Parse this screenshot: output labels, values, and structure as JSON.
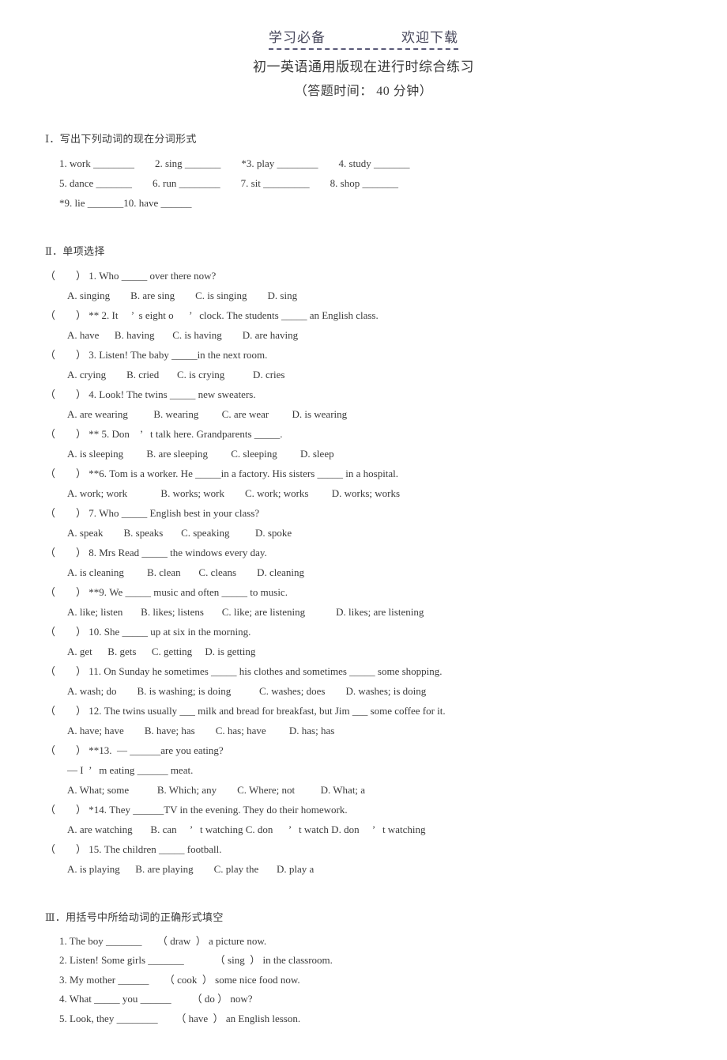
{
  "header": {
    "watermark_left": "学习必备",
    "watermark_right": "欢迎下载",
    "title": "初一英语通用版现在进行时综合练习",
    "subtitle": "（答题时间：  40 分钟）"
  },
  "section1": {
    "heading": "Ⅰ．写出下列动词的现在分词形式",
    "lines": [
      "1. work ________        2. sing _______        *3. play ________        4. study _______",
      "5. dance _______        6. run ________        7. sit _________        8. shop _______",
      "*9. lie _______10. have ______"
    ]
  },
  "section2": {
    "heading": "Ⅱ．单项选择",
    "items": [
      {
        "question": "（        ） 1. Who _____ over there now?",
        "options": "A. singing        B. are sing        C. is singing        D. sing"
      },
      {
        "question": "（        ） ** 2. It     ’  s eight o      ’   clock. The students _____ an English class.",
        "options": "A. have      B. having       C. is having        D. are having"
      },
      {
        "question": "（        ） 3. Listen! The baby _____in the next room.",
        "options": "A. crying        B. cried       C. is crying           D. cries"
      },
      {
        "question": "（        ） 4. Look! The twins _____ new sweaters.",
        "options": "A. are wearing          B. wearing         C. are wear         D. is wearing"
      },
      {
        "question": "（        ） ** 5. Don    ’   t talk here. Grandparents _____.",
        "options": "A. is sleeping         B. are sleeping         C. sleeping         D. sleep"
      },
      {
        "question": "（        ） **6. Tom is a worker. He _____in a factory. His sisters _____ in a hospital.",
        "options": "A. work; work             B. works; work        C. work; works         D. works; works"
      },
      {
        "question": "（        ） 7. Who _____ English best in your class?",
        "options": "A. speak        B. speaks       C. speaking          D. spoke"
      },
      {
        "question": "（        ） 8. Mrs Read _____ the windows every day.",
        "options": "A. is cleaning         B. clean       C. cleans        D. cleaning"
      },
      {
        "question": "（        ） **9. We _____ music and often _____ to music.",
        "options": "A. like; listen       B. likes; listens       C. like; are listening            D. likes; are listening"
      },
      {
        "question": "（        ） 10. She _____ up at six in the morning.",
        "options": "A. get      B. gets      C. getting     D. is getting"
      },
      {
        "question": "（        ） 11. On Sunday he sometimes _____ his clothes and sometimes _____ some shopping.",
        "options": "A. wash; do        B. is washing; is doing           C. washes; does        D. washes; is doing"
      },
      {
        "question": "（        ） 12. The twins usually ___ milk and bread for breakfast, but Jim ___ some coffee for it.",
        "options": "A. have; have        B. have; has        C. has; have         D. has; has"
      },
      {
        "question": "（        ） **13.  — ______are you eating?",
        "continuation": "— I  ’   m eating ______ meat.",
        "options": "A. What; some           B. Which; any        C. Where; not          D. What; a"
      },
      {
        "question": "（        ） *14. They ______TV in the evening. They do their homework.",
        "options": "A. are watching       B. can     ’   t watching C. don      ’   t watch D. don     ’   t watching"
      },
      {
        "question": "（        ） 15. The children _____ football.",
        "options": "A. is playing      B. are playing        C. play the       D. play a"
      }
    ]
  },
  "section3": {
    "heading": "Ⅲ．用括号中所给动词的正确形式填空",
    "lines": [
      "1. The boy _______      （ draw  ） a picture now.",
      "2. Listen! Some girls _______            （ sing  ） in the classroom.",
      "3. My mother ______      （ cook  ） some nice food now.",
      "4. What _____ you ______        （ do ） now?",
      "5. Look, they ________       （ have  ） an English lesson."
    ]
  }
}
